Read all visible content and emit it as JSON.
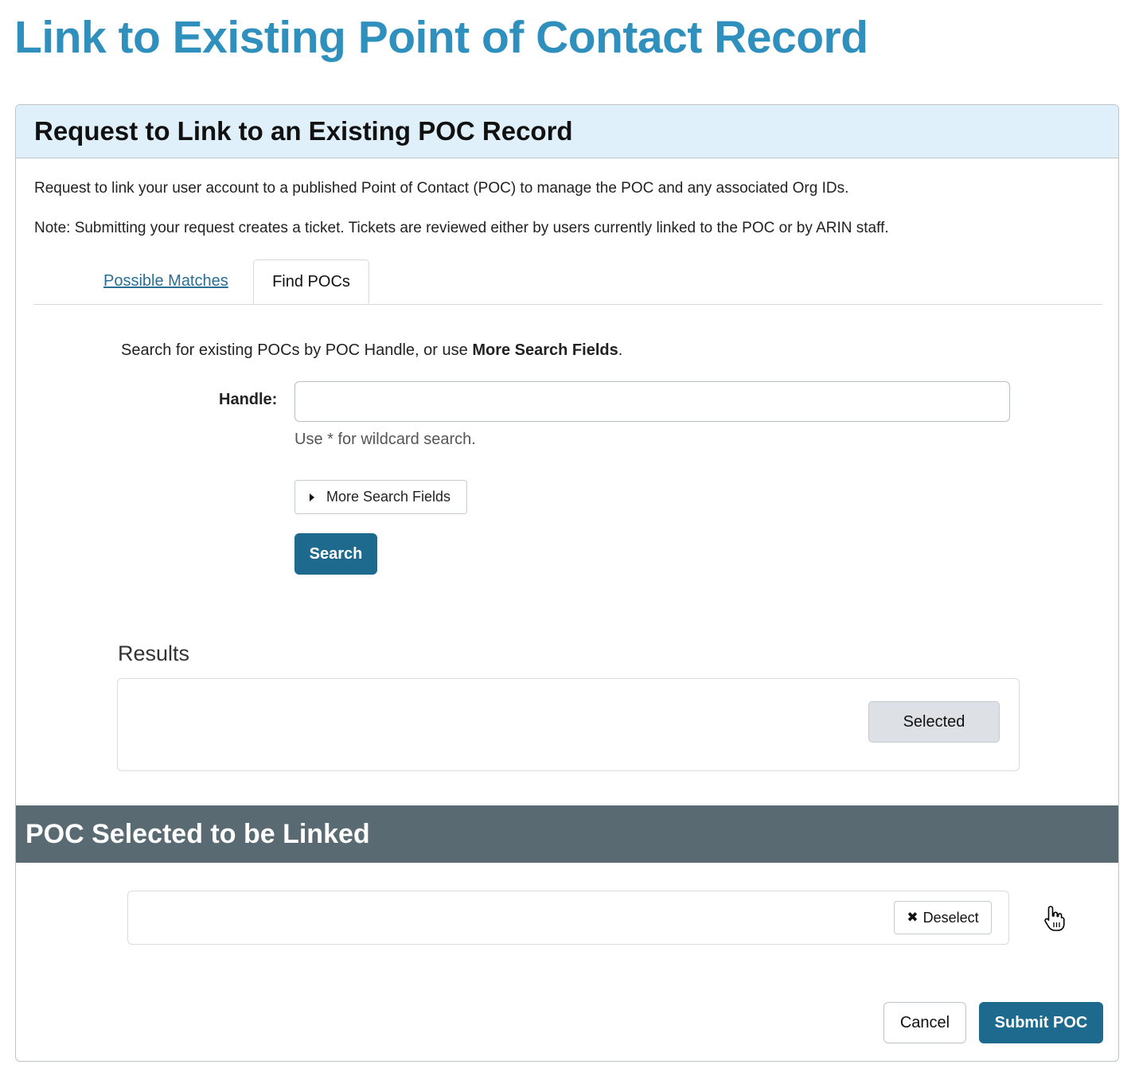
{
  "page": {
    "title": "Link to Existing Point of Contact Record"
  },
  "panel": {
    "title": "Request to Link to an Existing POC Record",
    "description": "Request to link your user account to a published Point of Contact (POC) to manage the POC and any associated Org IDs.",
    "note": "Note: Submitting your request creates a ticket. Tickets are reviewed either by users currently linked to the POC or by ARIN staff."
  },
  "tabs": {
    "possible_matches": "Possible Matches",
    "find_pocs": "Find POCs"
  },
  "search": {
    "intro_prefix": "Search for existing POCs by POC Handle, or use ",
    "intro_bold": "More Search Fields",
    "intro_suffix": ".",
    "handle_label": "Handle:",
    "handle_value": "",
    "help": "Use * for wildcard search.",
    "more_fields_label": "More Search Fields",
    "search_button": "Search"
  },
  "results": {
    "title": "Results",
    "selected_button": "Selected"
  },
  "linked": {
    "title": "POC Selected to be Linked",
    "deselect_button": "Deselect"
  },
  "actions": {
    "cancel": "Cancel",
    "submit": "Submit POC"
  },
  "icons": {
    "caret": "caret-right-icon",
    "deselect": "close-icon",
    "cursor": "hand-pointer-icon"
  },
  "colors": {
    "title": "#2f8fbd",
    "header_bg": "#dff0fb",
    "primary": "#1d6a8e",
    "linked_header_bg": "#5a6a73"
  }
}
